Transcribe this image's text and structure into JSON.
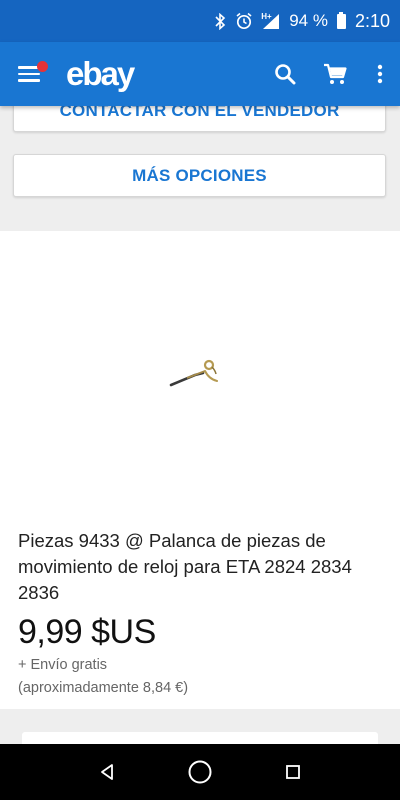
{
  "status_bar": {
    "battery_percent": "94 %",
    "time": "2:10",
    "network": "H+",
    "icons": [
      "bluetooth-icon",
      "alarm-icon",
      "signal-icon",
      "battery-icon"
    ]
  },
  "app_bar": {
    "logo": "ebay",
    "icons": [
      "menu-icon",
      "search-icon",
      "cart-icon",
      "overflow-menu-icon"
    ],
    "notification_color": "#e53238"
  },
  "buttons": {
    "contact_seller": "CONTACTAR CON EL VENDEDOR",
    "more_options": "MÁS OPCIONES"
  },
  "product": {
    "title": "Piezas 9433 @ Palanca de piezas de movimiento de reloj para ETA 2824 2834 2836",
    "price": "9,99 $US",
    "shipping": "+ Envío gratis",
    "approx_price": "(aproximadamente 8,84 €)",
    "image_icon": "watch-lever-part-image"
  },
  "nav_bar": {
    "icons": [
      "back-icon",
      "home-icon",
      "recents-icon"
    ]
  },
  "colors": {
    "status_bar": "#1565c0",
    "app_bar": "#1976d2",
    "accent": "#1976d2"
  }
}
